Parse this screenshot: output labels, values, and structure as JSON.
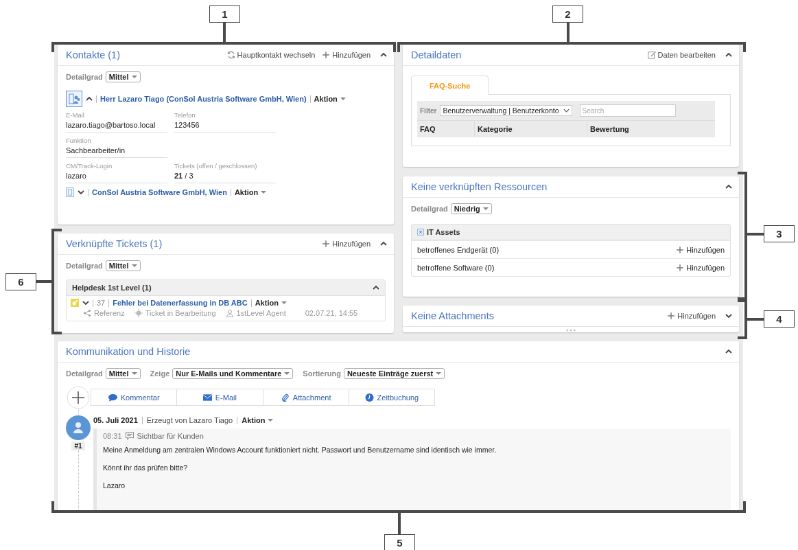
{
  "callouts": [
    "1",
    "2",
    "3",
    "4",
    "5",
    "6"
  ],
  "contacts": {
    "title": "Kontakte (1)",
    "switch_action": "Hauptkontakt wechseln",
    "add_action": "Hinzufügen",
    "expanded": true,
    "detail": {
      "label": "Detailgrad",
      "value": "Mittel"
    },
    "person": {
      "name": "Herr Lazaro Tiago (ConSol Austria Software GmbH, Wien)",
      "action": "Aktion",
      "expanded": true
    },
    "field_rows": [
      [
        {
          "label": "E-Mail",
          "value": "lazaro.tiago@bartoso.local"
        },
        {
          "label": "Telefon",
          "value": "123456"
        }
      ],
      [
        {
          "label": "Funktion",
          "value": "Sachbearbeiter/in"
        }
      ],
      [
        {
          "label": "CM/Track-Login",
          "value": "lazaro"
        },
        {
          "label": "Tickets (offen / geschlossen)",
          "value": "**21** / 3"
        }
      ]
    ],
    "company": {
      "name": "ConSol Austria Software GmbH, Wien",
      "action": "Aktion",
      "expanded": false
    }
  },
  "tickets": {
    "title": "Verknüpfte Tickets (1)",
    "add_action": "Hinzufügen",
    "expanded": true,
    "detail": {
      "label": "Detailgrad",
      "value": "Mittel"
    },
    "group": {
      "title": "Helpdesk 1st Level (1)",
      "expanded": true,
      "items": [
        {
          "expanded": false,
          "number": "37",
          "title": "Fehler bei Datenerfassung in DB ABC",
          "action": "Aktion",
          "relation": "Referenz",
          "status": "Ticket in Bearbeitung",
          "agent": "1stLevel Agent",
          "date": "02.07.21, 14:55"
        }
      ]
    }
  },
  "details": {
    "title": "Detaildaten",
    "edit_action": "Daten bearbeiten",
    "expanded": true,
    "tabs": [
      {
        "label": "FAQ-Suche",
        "selected": true
      }
    ],
    "filter": {
      "label": "Filter",
      "value": "Benutzerverwaltung | Benutzerkonto"
    },
    "search": {
      "placeholder": "Search"
    },
    "columns": [
      "FAQ",
      "Kategorie",
      "Bewertung"
    ]
  },
  "resources": {
    "title": "Keine verknüpften Ressourcen",
    "expanded": true,
    "detail": {
      "label": "Detailgrad",
      "value": "Niedrig"
    },
    "group": {
      "title": "IT Assets",
      "rows": [
        {
          "label": "betroffenes Endgerät (0)",
          "action": "Hinzufügen"
        },
        {
          "label": "betroffene Software (0)",
          "action": "Hinzufügen"
        }
      ]
    }
  },
  "attachments": {
    "title": "Keine Attachments",
    "add_action": "Hinzufügen",
    "expanded": false
  },
  "history": {
    "title": "Kommunikation und Historie",
    "expanded": true,
    "filters": [
      {
        "label": "Detailgrad",
        "value": "Mittel"
      },
      {
        "label": "Zeige",
        "value": "Nur E-Mails und Kommentare"
      },
      {
        "label": "Sortierung",
        "value": "Neueste Einträge zuerst"
      }
    ],
    "create": [
      {
        "kind": "comment",
        "label": "Kommentar"
      },
      {
        "kind": "email",
        "label": "E-Mail"
      },
      {
        "kind": "attachment",
        "label": "Attachment"
      },
      {
        "kind": "time",
        "label": "Zeitbuchung"
      }
    ],
    "entries": [
      {
        "date": "05. Juli 2021",
        "author": "Erzeugt von Lazaro Tiago",
        "action": "Aktion",
        "number": "#1",
        "time": "08:31",
        "visibility": "Sichtbar für Kunden",
        "lines": [
          "Meine Anmeldung am zentralen Windows Account funktioniert nicht. Passwort und Benutzername sind identisch wie immer.",
          "Könnt ihr das prüfen bitte?",
          "Lazaro"
        ]
      }
    ]
  }
}
